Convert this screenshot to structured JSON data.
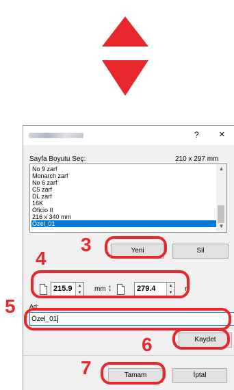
{
  "dialog": {
    "help": "?",
    "close": "×",
    "paper_size_label": "Sayfa Boyutu Seç:",
    "paper_size_value": "210 x 297 mm",
    "list_items": [
      "No 9 zarf",
      "Monarch zarf",
      "No 6 zarf",
      "C5 zarf",
      "DL zarf",
      "16K",
      "Oficio II",
      "216 x 340 mm",
      "Özel_01"
    ],
    "selected_item": "Özel_01",
    "new_button": "Yeni",
    "delete_button": "Sil",
    "width_value": "215.9",
    "width_unit": "mm",
    "height_value": "279.4",
    "height_unit": "r",
    "name_label": "Ad:",
    "name_value": "Özel_01",
    "save_button": "Kaydet",
    "ok_button": "Tamam",
    "cancel_button": "İptal"
  },
  "callouts": {
    "n3": "3",
    "n4": "4",
    "n5": "5",
    "n6": "6",
    "n7": "7"
  },
  "colors": {
    "accent_red": "#e8272c",
    "selection_blue": "#0078d7"
  }
}
